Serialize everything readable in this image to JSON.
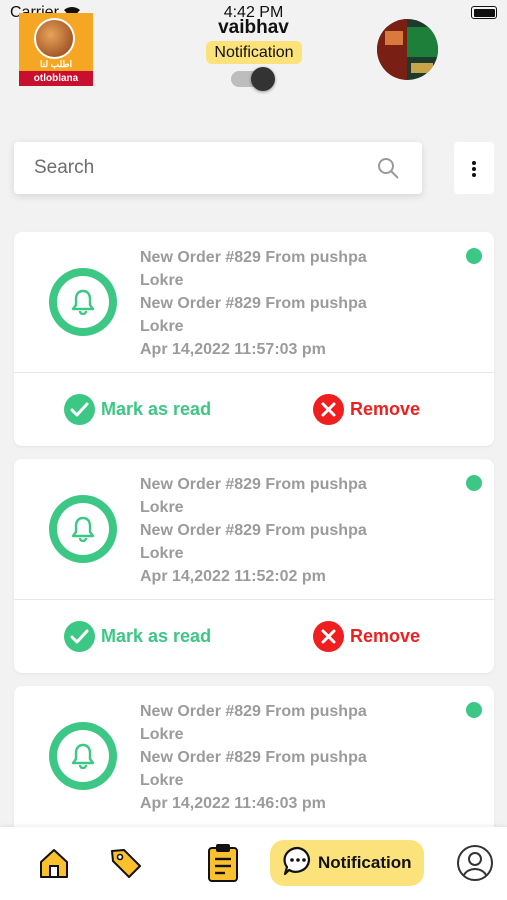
{
  "status_bar": {
    "carrier": "Carrier",
    "time": "4:42 PM"
  },
  "header": {
    "logo_arabic": "اطلب لنا",
    "logo_name": "otloblana",
    "username": "vaibhav",
    "mode_chip": "Notification",
    "toggle_on": true
  },
  "search": {
    "placeholder": "Search"
  },
  "notifications": [
    {
      "line1": "New Order #829 From pushpa",
      "line2": "Lokre",
      "line3": "New Order #829 From pushpa",
      "line4": "Lokre",
      "time": "Apr 14,2022 11:57:03 pm",
      "unread": true
    },
    {
      "line1": "New Order #829 From pushpa",
      "line2": "Lokre",
      "line3": "New Order #829 From pushpa",
      "line4": "Lokre",
      "time": "Apr 14,2022 11:52:02 pm",
      "unread": true
    },
    {
      "line1": "New Order #829 From pushpa",
      "line2": "Lokre",
      "line3": "New Order #829 From pushpa",
      "line4": "Lokre",
      "time": "Apr 14,2022 11:46:03 pm",
      "unread": true
    }
  ],
  "actions": {
    "mark_read": "Mark as read",
    "remove": "Remove"
  },
  "bottom_nav": {
    "items": [
      "home-icon",
      "tag-icon",
      "clipboard-icon",
      "chat-icon",
      "profile-icon"
    ],
    "active_label": "Notification"
  },
  "colors": {
    "accent_green": "#3dc785",
    "danger_red": "#f01f1f",
    "chip_yellow": "#fbe27a"
  }
}
